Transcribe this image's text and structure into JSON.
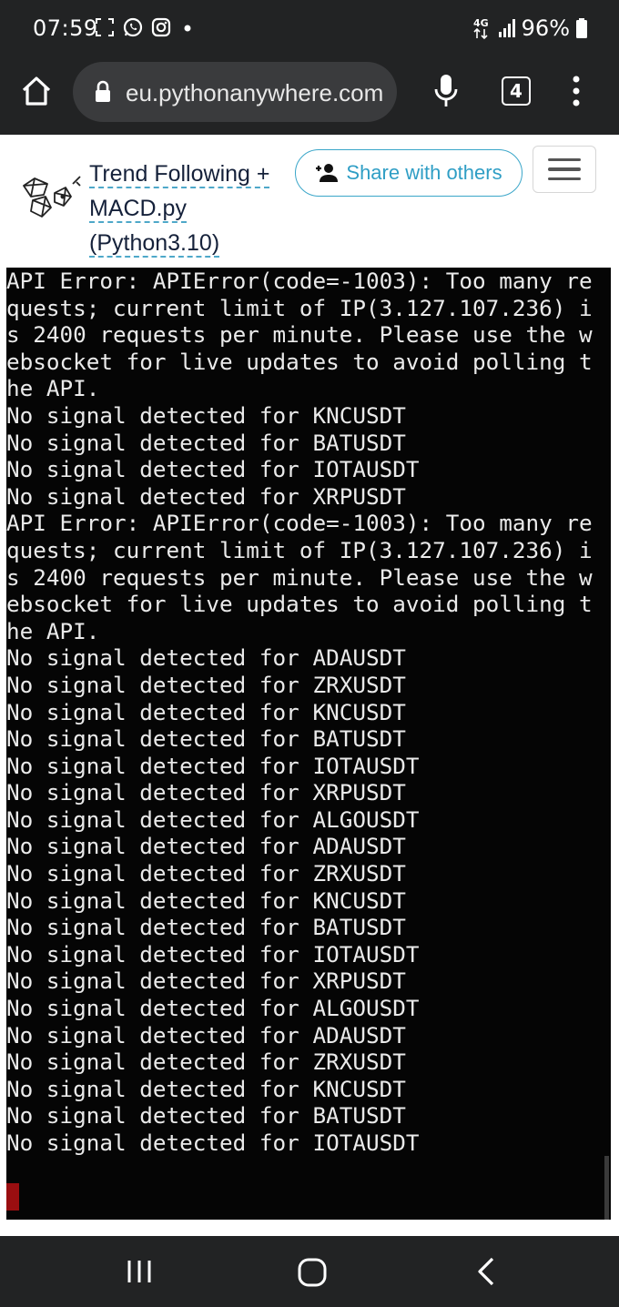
{
  "status_bar": {
    "time": "07:59",
    "network": "4G",
    "battery": "96%"
  },
  "browser": {
    "url": "eu.pythonanywhere.com",
    "tab_count": "4"
  },
  "header": {
    "title_lines": [
      "Trend Following +",
      "MACD.py",
      "(Python3.10)"
    ],
    "share_label": "Share with others"
  },
  "terminal": {
    "lines": [
      "API Error: APIError(code=-1003): Too many re",
      "quests; current limit of IP(3.127.107.236) i",
      "s 2400 requests per minute. Please use the w",
      "ebsocket for live updates to avoid polling t",
      "he API.",
      "No signal detected for KNCUSDT",
      "No signal detected for BATUSDT",
      "No signal detected for IOTAUSDT",
      "No signal detected for XRPUSDT",
      "API Error: APIError(code=-1003): Too many re",
      "quests; current limit of IP(3.127.107.236) i",
      "s 2400 requests per minute. Please use the w",
      "ebsocket for live updates to avoid polling t",
      "he API.",
      "No signal detected for ADAUSDT",
      "No signal detected for ZRXUSDT",
      "No signal detected for KNCUSDT",
      "No signal detected for BATUSDT",
      "No signal detected for IOTAUSDT",
      "No signal detected for XRPUSDT",
      "No signal detected for ALGOUSDT",
      "No signal detected for ADAUSDT",
      "No signal detected for ZRXUSDT",
      "No signal detected for KNCUSDT",
      "No signal detected for BATUSDT",
      "No signal detected for IOTAUSDT",
      "No signal detected for XRPUSDT",
      "No signal detected for ALGOUSDT",
      "No signal detected for ADAUSDT",
      "No signal detected for ZRXUSDT",
      "No signal detected for KNCUSDT",
      "No signal detected for BATUSDT",
      "No signal detected for IOTAUSDT"
    ]
  },
  "colors": {
    "chrome_dark": "#222324",
    "terminal_bg": "#050505",
    "terminal_text": "#eaeaea",
    "cursor": "#9a0e10",
    "share_accent": "#2f9ec5",
    "title_text": "#15213a"
  },
  "icons": {
    "status": [
      "screenshot-icon",
      "whatsapp-icon",
      "instagram-icon",
      "notification-dot-icon",
      "signal-icon",
      "battery-icon"
    ],
    "toolbar": [
      "home-icon",
      "lock-icon",
      "mic-icon",
      "tabs-icon",
      "more-vert-icon"
    ],
    "nav": [
      "recents-icon",
      "home-nav-icon",
      "back-icon"
    ]
  }
}
